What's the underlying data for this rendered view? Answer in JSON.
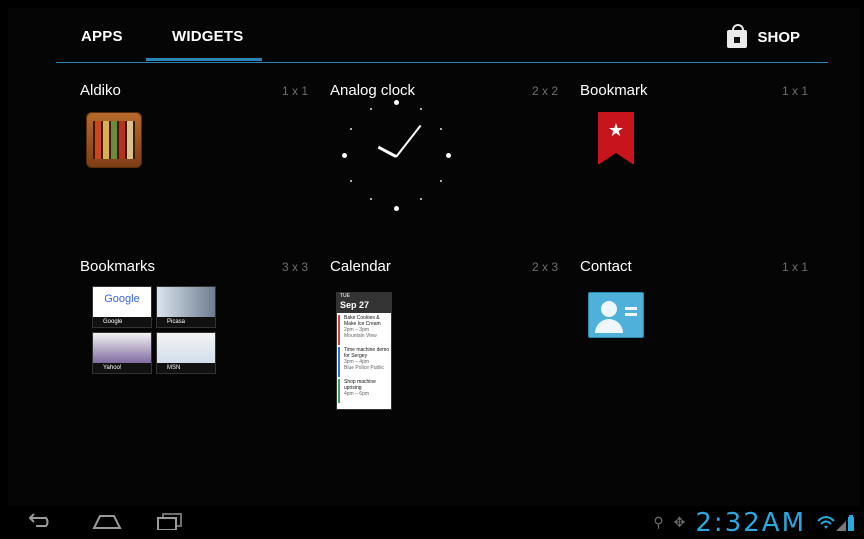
{
  "tabs": {
    "apps_label": "APPS",
    "widgets_label": "WIDGETS",
    "shop_label": "SHOP",
    "active_color": "#2a86b8"
  },
  "widgets": [
    {
      "name": "Aldiko",
      "size": "1 x 1"
    },
    {
      "name": "Analog clock",
      "size": "2 x 2"
    },
    {
      "name": "Bookmark",
      "size": "1 x 1"
    },
    {
      "name": "Bookmarks",
      "size": "3 x 3"
    },
    {
      "name": "Calendar",
      "size": "2 x 3"
    },
    {
      "name": "Contact",
      "size": "1 x 1"
    }
  ],
  "bookmarks_preview": {
    "items": [
      {
        "label": "Google",
        "title": "Google"
      },
      {
        "label": "Picasa"
      },
      {
        "label": "Yahoo!"
      },
      {
        "label": "MSN"
      }
    ]
  },
  "calendar_preview": {
    "day": "TUE",
    "date": "Sep 27",
    "events": [
      {
        "title": "Bake Cookies & Make Ice Cream",
        "time": "2pm – 3pm",
        "place": "Mountain View"
      },
      {
        "title": "Time machine demo for Sergey",
        "time": "3pm – 4pm",
        "place": "Blue Police Public"
      },
      {
        "title": "Shop machine uprising",
        "time": "4pm – 6pm",
        "place": ""
      }
    ]
  },
  "status_bar": {
    "time": "2:32AM",
    "accent": "#2aa8e0"
  }
}
